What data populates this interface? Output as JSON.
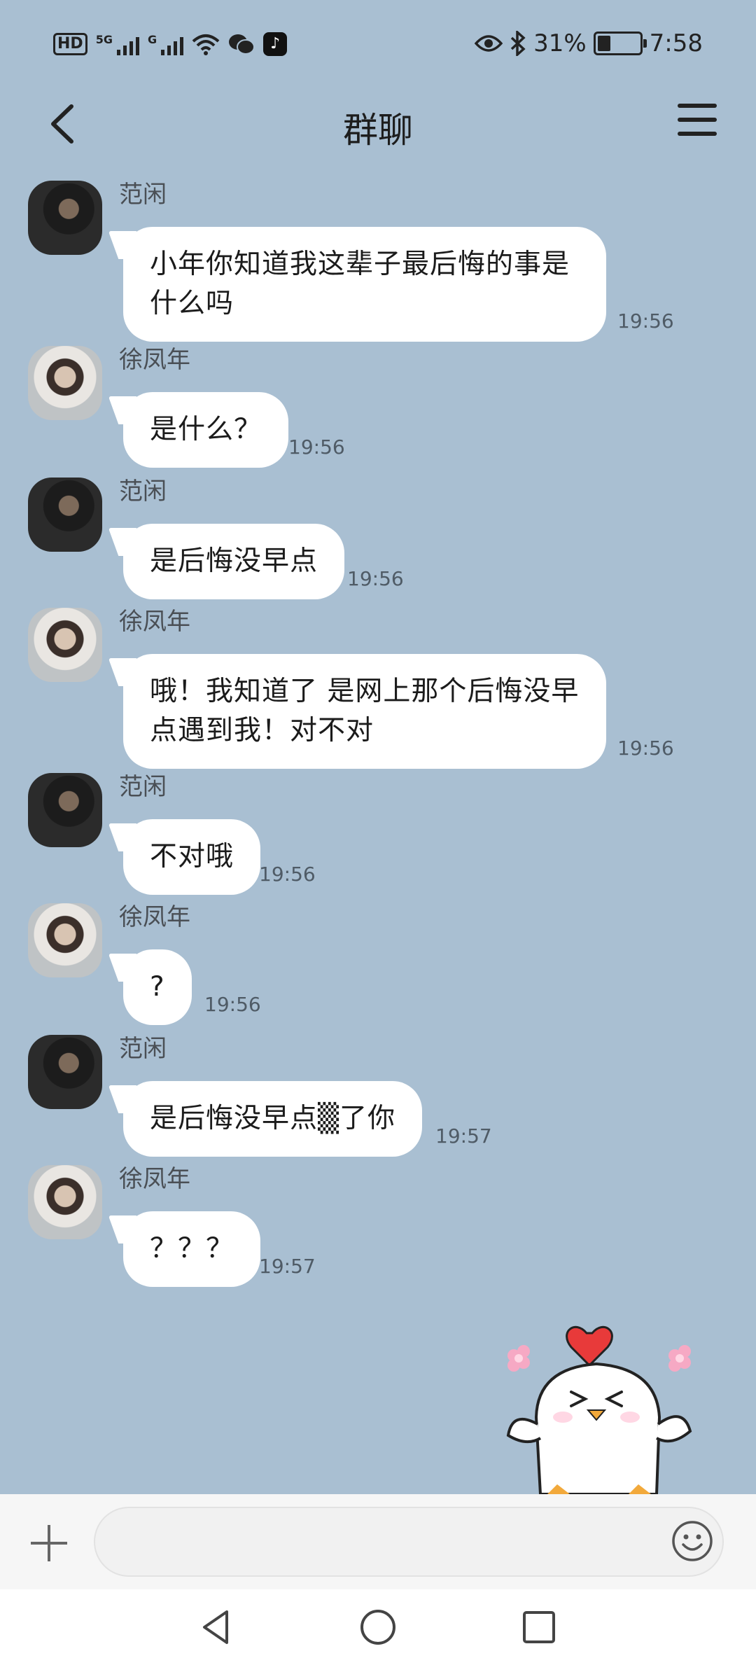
{
  "status_bar": {
    "hd_label": "HD",
    "sim1_tag": "5G",
    "sim2_tag": "G",
    "battery_text": "31%",
    "battery_level": 0.31,
    "time": "7:58",
    "icons": [
      "hd-icon",
      "signal-icon",
      "wifi-icon",
      "wechat-icon",
      "tiktok-icon",
      "eye-icon",
      "bluetooth-icon",
      "battery-icon"
    ]
  },
  "header": {
    "title": "群聊",
    "back_icon": "chevron-left-icon",
    "menu_icon": "hamburger-menu-icon"
  },
  "messages": [
    {
      "sender": "范闲",
      "text": "小年你知道我这辈子最后悔的事是什么吗",
      "time": "19:56",
      "avatar": "avatar-dark"
    },
    {
      "sender": "徐凤年",
      "text": "是什么？",
      "time": "19:56",
      "avatar": "avatar-light"
    },
    {
      "sender": "范闲",
      "text": "是后悔没早点",
      "time": "19:56",
      "avatar": "avatar-dark"
    },
    {
      "sender": "徐凤年",
      "text": "哦！我知道了 是网上那个后悔没早点遇到我！对不对",
      "time": "19:56",
      "avatar": "avatar-light"
    },
    {
      "sender": "范闲",
      "text": "不对哦",
      "time": "19:56",
      "avatar": "avatar-dark"
    },
    {
      "sender": "徐凤年",
      "text": "?",
      "time": "19:56",
      "avatar": "avatar-light"
    },
    {
      "sender": "范闲",
      "text": "是后悔没早点▒了你",
      "time": "19:57",
      "avatar": "avatar-dark"
    },
    {
      "sender": "徐凤年",
      "text": "？？？",
      "time": "19:57",
      "avatar": "avatar-light"
    }
  ],
  "input_bar": {
    "placeholder": "",
    "plus_icon": "plus-icon",
    "emoji_icon": "smiley-icon"
  },
  "system_nav": {
    "icons": [
      "back-triangle-icon",
      "home-circle-icon",
      "recents-square-icon"
    ]
  },
  "colors": {
    "chat_background": "#a9bfd2",
    "bubble": "#ffffff",
    "input_bar": "#f6f6f6"
  }
}
